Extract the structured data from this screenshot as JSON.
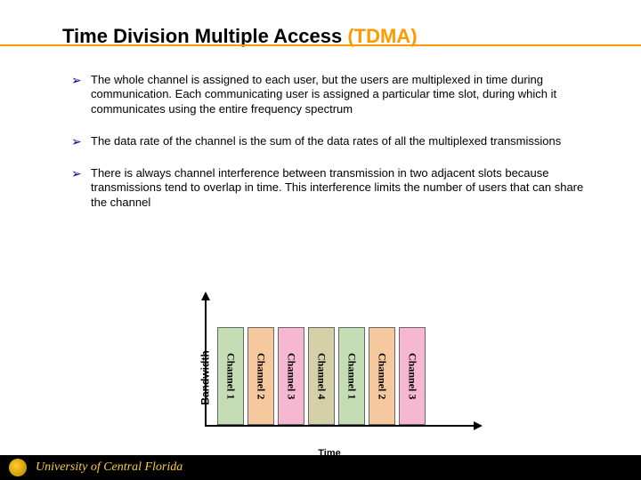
{
  "title_main": "Time Division Multiple Access ",
  "title_accent": "(TDMA)",
  "bullets": [
    "The whole channel is assigned to each user, but the users are multiplexed in time during communication. Each communicating user is assigned a particular time slot, during which it communicates using the entire frequency spectrum",
    "The data rate of the channel is the sum of the data rates of all the multiplexed transmissions",
    "There is always channel interference between transmission in two adjacent slots because transmissions tend to overlap in time. This interference limits the number of users that can share the channel"
  ],
  "chart_data": {
    "type": "bar",
    "xlabel": "Time",
    "ylabel": "Bandwidth",
    "series": [
      {
        "label": "Channel 1",
        "color": "#c5ddb5"
      },
      {
        "label": "Channel 2",
        "color": "#f6c89e"
      },
      {
        "label": "Channel 3",
        "color": "#f5b8d0"
      },
      {
        "label": "Channel 4",
        "color": "#d4d0a8"
      },
      {
        "label": "Channel 1",
        "color": "#c5ddb5"
      },
      {
        "label": "Channel 2",
        "color": "#f6c89e"
      },
      {
        "label": "Channel 3",
        "color": "#f5b8d0"
      }
    ]
  },
  "footer": "University of Central Florida"
}
